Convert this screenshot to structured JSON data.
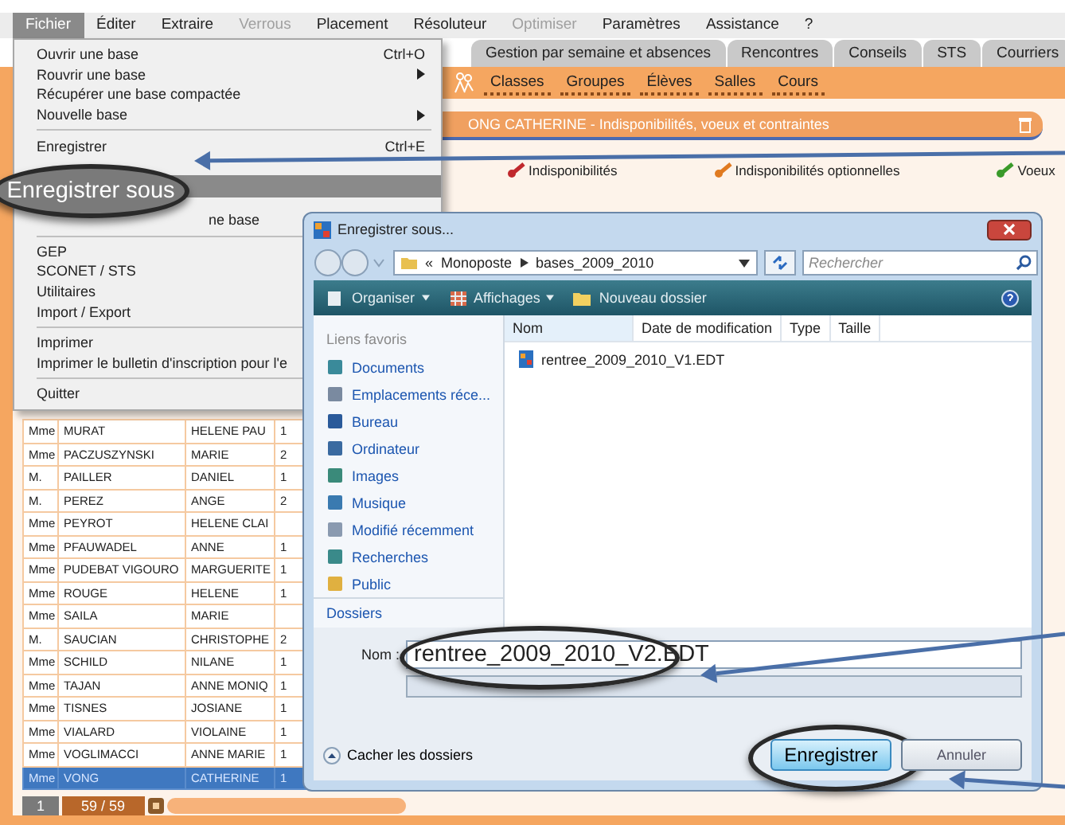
{
  "menu_bar": [
    {
      "label": "Fichier",
      "selected": true,
      "disabled": false
    },
    {
      "label": "Éditer",
      "selected": false,
      "disabled": false
    },
    {
      "label": "Extraire",
      "selected": false,
      "disabled": false
    },
    {
      "label": "Verrous",
      "selected": false,
      "disabled": true
    },
    {
      "label": "Placement",
      "selected": false,
      "disabled": false
    },
    {
      "label": "Résoluteur",
      "selected": false,
      "disabled": false
    },
    {
      "label": "Optimiser",
      "selected": false,
      "disabled": true
    },
    {
      "label": "Paramètres",
      "selected": false,
      "disabled": false
    },
    {
      "label": "Assistance",
      "selected": false,
      "disabled": false
    },
    {
      "label": "?",
      "selected": false,
      "disabled": false
    }
  ],
  "file_menu": {
    "items": [
      {
        "kind": "item",
        "label": "Ouvrir une base",
        "shortcut": "Ctrl+O",
        "selected": false
      },
      {
        "kind": "submenu",
        "label": "Rouvrir une base",
        "selected": false
      },
      {
        "kind": "item",
        "label": "Récupérer une base compactée",
        "selected": false
      },
      {
        "kind": "submenu",
        "label": "Nouvelle base",
        "selected": false
      },
      {
        "kind": "separator"
      },
      {
        "kind": "item",
        "label": "Enregistrer",
        "shortcut": "Ctrl+E",
        "selected": false
      },
      {
        "kind": "item",
        "label": "Enregistrer sous",
        "selected": true,
        "callout": true
      },
      {
        "kind": "covered",
        "label": "ne base",
        "selected": false
      },
      {
        "kind": "separator"
      },
      {
        "kind": "item",
        "label": "GEP",
        "selected": false
      },
      {
        "kind": "item",
        "label": "SCONET / STS",
        "selected": false
      },
      {
        "kind": "item",
        "label": "Utilitaires",
        "selected": false
      },
      {
        "kind": "item",
        "label": "Import / Export",
        "selected": false
      },
      {
        "kind": "separator"
      },
      {
        "kind": "item",
        "label": "Imprimer",
        "selected": false
      },
      {
        "kind": "item",
        "label": "Imprimer le bulletin d'inscription pour l'e",
        "selected": false
      },
      {
        "kind": "separator"
      },
      {
        "kind": "item",
        "label": "Quitter",
        "selected": false
      }
    ]
  },
  "tabs": [
    {
      "label": "Gestion par semaine et absences",
      "selected": false
    },
    {
      "label": "Rencontres",
      "selected": false
    },
    {
      "label": "Conseils",
      "selected": false
    },
    {
      "label": "STS",
      "selected": false
    },
    {
      "label": "Courriers",
      "selected": false
    }
  ],
  "sub_tabs": [
    {
      "label": "Classes",
      "selected": false
    },
    {
      "label": "Groupes",
      "selected": false
    },
    {
      "label": "Élèves",
      "selected": false
    },
    {
      "label": "Salles",
      "selected": false
    },
    {
      "label": "Cours",
      "selected": false
    }
  ],
  "panel": {
    "title": "ONG CATHERINE - Indisponibilités, voeux et contraintes",
    "legend": [
      {
        "label": "Indisponibilités",
        "color": "#c0282d"
      },
      {
        "label": "Indisponibilités optionnelles",
        "color": "#e07a20"
      },
      {
        "label": "Voeux",
        "color": "#3a9a2a"
      }
    ]
  },
  "table": {
    "rows": [
      {
        "cells": [
          "Mme",
          "MURAT",
          "HELENE PAU",
          "1"
        ],
        "selected": false
      },
      {
        "cells": [
          "Mme",
          "PACZUSZYNSKI",
          "MARIE",
          "2"
        ],
        "selected": false
      },
      {
        "cells": [
          "M.",
          "PAILLER",
          "DANIEL",
          "1"
        ],
        "selected": false
      },
      {
        "cells": [
          "M.",
          "PEREZ",
          "ANGE",
          "2"
        ],
        "selected": false
      },
      {
        "cells": [
          "Mme",
          "PEYROT",
          "HELENE CLAI"
        ],
        "selected": false
      },
      {
        "cells": [
          "Mme",
          "PFAUWADEL",
          "ANNE",
          "1"
        ],
        "selected": false
      },
      {
        "cells": [
          "Mme",
          "PUDEBAT VIGOURO",
          "MARGUERITE",
          "1"
        ],
        "selected": false
      },
      {
        "cells": [
          "Mme",
          "ROUGE",
          "HELENE",
          "1"
        ],
        "selected": false
      },
      {
        "cells": [
          "Mme",
          "SAILA",
          "MARIE"
        ],
        "selected": false
      },
      {
        "cells": [
          "M.",
          "SAUCIAN",
          "CHRISTOPHE",
          "2"
        ],
        "selected": false
      },
      {
        "cells": [
          "Mme",
          "SCHILD",
          "NILANE",
          "1"
        ],
        "selected": false
      },
      {
        "cells": [
          "Mme",
          "TAJAN",
          "ANNE MONIQ",
          "1"
        ],
        "selected": false
      },
      {
        "cells": [
          "Mme",
          "TISNES",
          "JOSIANE",
          "1"
        ],
        "selected": false
      },
      {
        "cells": [
          "Mme",
          "VIALARD",
          "VIOLAINE",
          "1"
        ],
        "selected": false
      },
      {
        "cells": [
          "Mme",
          "VOGLIMACCI",
          "ANNE MARIE",
          "1"
        ],
        "selected": false
      },
      {
        "cells": [
          "Mme",
          "VONG",
          "CATHERINE",
          "1"
        ],
        "selected": true
      }
    ]
  },
  "status_bar": {
    "page": "1",
    "count": "59 / 59"
  },
  "dialog": {
    "title": "Enregistrer sous...",
    "path": [
      "Monoposte",
      "bases_2009_2010"
    ],
    "path_prefix": "«",
    "search": {
      "placeholder": "Rechercher"
    },
    "toolbar": [
      {
        "label": "Organiser",
        "dropdown": true
      },
      {
        "label": "Affichages",
        "dropdown": true
      },
      {
        "label": "Nouveau dossier",
        "dropdown": false
      }
    ],
    "favorites_title": "Liens favoris",
    "favorites": [
      "Documents",
      "Emplacements réce...",
      "Bureau",
      "Ordinateur",
      "Images",
      "Musique",
      "Modifié récemment",
      "Recherches",
      "Public"
    ],
    "folders_label": "Dossiers",
    "columns": [
      "Nom",
      "Date de modification",
      "Type",
      "Taille"
    ],
    "files": [
      "rentree_2009_2010_V1.EDT"
    ],
    "name_label": "Nom :",
    "file_name": {
      "value": "rentree_2009_2010_V2.EDT",
      "callout": true
    },
    "hide_folders": "Cacher les dossiers",
    "buttons": [
      {
        "label": "Enregistrer",
        "kind": "primary",
        "callout": true
      },
      {
        "label": "Annuler",
        "kind": "secondary",
        "callout": false
      }
    ]
  }
}
